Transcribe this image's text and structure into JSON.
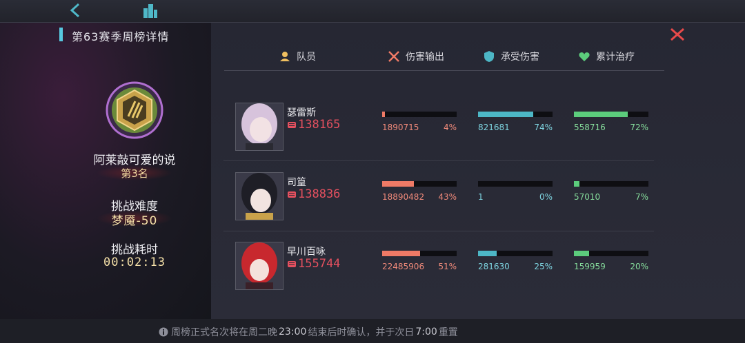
{
  "window": {
    "title": "第63赛季周榜详情"
  },
  "headers": {
    "member": "队员",
    "damage": "伤害输出",
    "taken": "承受伤害",
    "healing": "累计治疗"
  },
  "player": {
    "name": "阿莱敲可爱的说",
    "rank": "第3名",
    "difficulty_label": "挑战难度",
    "difficulty_value": "梦魇-50",
    "time_label": "挑战耗时",
    "time_value": "00:02:13"
  },
  "members": [
    {
      "name": "瑟雷斯",
      "power": "138165",
      "damage": {
        "value": "1890715",
        "pct": "4%",
        "fraction": 0.04
      },
      "taken": {
        "value": "821681",
        "pct": "74%",
        "fraction": 0.74
      },
      "healing": {
        "value": "558716",
        "pct": "72%",
        "fraction": 0.72
      },
      "hair": "#d7c3dc"
    },
    {
      "name": "司篁",
      "power": "138836",
      "damage": {
        "value": "18890482",
        "pct": "43%",
        "fraction": 0.43
      },
      "taken": {
        "value": "1",
        "pct": "0%",
        "fraction": 0.0
      },
      "healing": {
        "value": "57010",
        "pct": "7%",
        "fraction": 0.07
      },
      "hair": "#1e1e26"
    },
    {
      "name": "早川百咏",
      "power": "155744",
      "damage": {
        "value": "22485906",
        "pct": "51%",
        "fraction": 0.51
      },
      "taken": {
        "value": "281630",
        "pct": "25%",
        "fraction": 0.25
      },
      "healing": {
        "value": "159959",
        "pct": "20%",
        "fraction": 0.2
      },
      "hair": "#c8282e"
    }
  ],
  "footer": {
    "notice_a": "周榜正式名次将在周二晚",
    "notice_t1": "23:00",
    "notice_b": "结束后时确认，并于次日",
    "notice_t2": "7:00",
    "notice_c": "重置"
  },
  "colors": {
    "damage": "#ef7a66",
    "taken": "#4db7c6",
    "healing": "#5ccc7c",
    "power": "#e4505f",
    "accent": "#57c8e0",
    "close": "#e84a4a"
  },
  "icons": {
    "back": "back-arrow-icon",
    "city": "city-icon",
    "close": "close-icon",
    "member": "member-icon",
    "damage": "crossed-swords-icon",
    "taken": "shield-icon",
    "healing": "heart-icon",
    "power": "fist-icon",
    "info": "info-icon"
  }
}
